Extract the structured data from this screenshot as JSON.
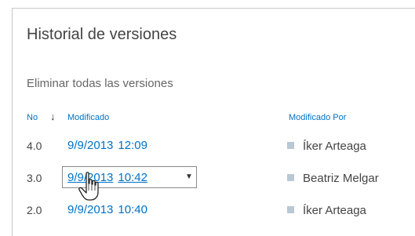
{
  "dialog": {
    "title": "Historial de versiones",
    "delete_all_label": "Eliminar todas las versiones"
  },
  "table": {
    "headers": {
      "no": "No",
      "modified": "Modificado",
      "modified_by": "Modificado Por"
    },
    "sort_indicator": "down-arrow-icon",
    "rows": [
      {
        "no": "4.0",
        "date": "9/9/2013",
        "time": "12:09",
        "user": "Íker Arteaga"
      },
      {
        "no": "3.0",
        "date": "9/9/2013",
        "time": "10:42",
        "user": "Beatriz Melgar"
      },
      {
        "no": "2.0",
        "date": "9/9/2013",
        "time": "10:40",
        "user": "Íker Arteaga"
      }
    ]
  },
  "icons": {
    "presence": "presence-status-icon",
    "dropdown": "dropdown-caret-icon",
    "cursor": "hand-pointer-cursor-icon"
  },
  "colors": {
    "link": "#0072c6",
    "title_text": "#444444",
    "presence_square": "#b8c8d4",
    "panel_border": "#c8c8c8"
  }
}
